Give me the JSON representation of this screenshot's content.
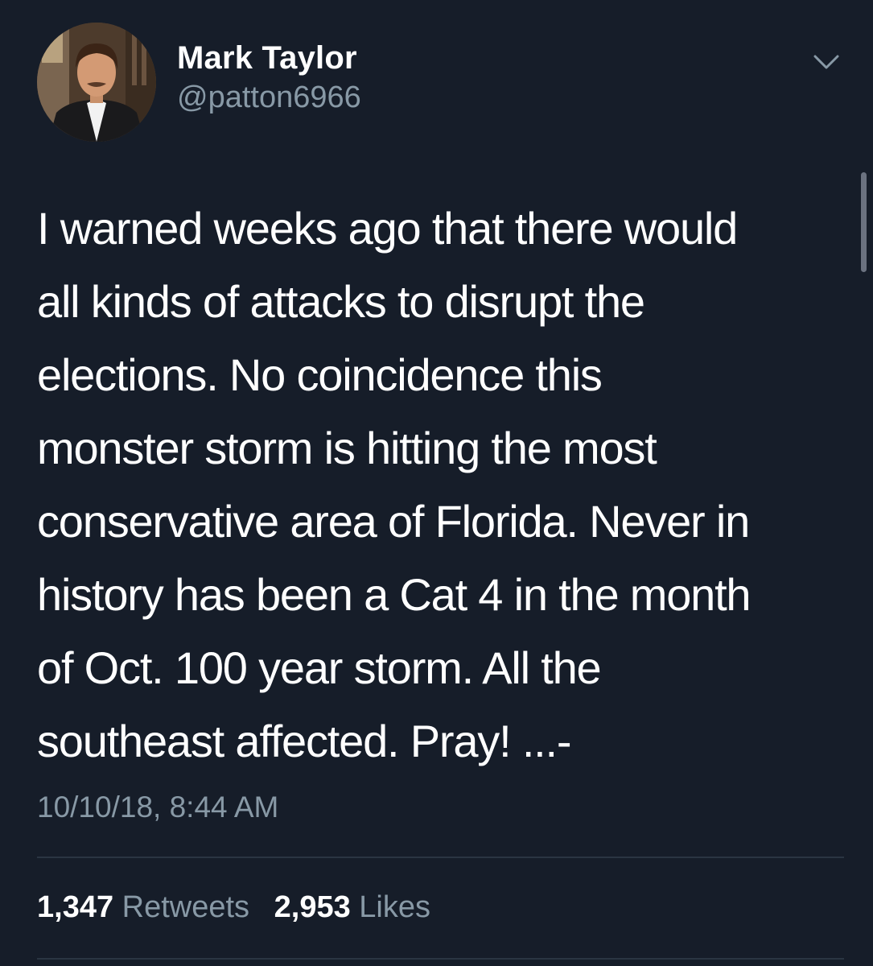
{
  "author": {
    "name": "Mark Taylor",
    "handle": "@patton6966",
    "avatar_icon": "profile-photo"
  },
  "menu_icon": "chevron-down-icon",
  "tweet": {
    "lines": [
      "I warned weeks ago that there would",
      "all kinds of attacks to disrupt the",
      "elections. No coincidence this",
      "monster storm is hitting the most",
      "conservative area of Florida. Never in",
      "history has been a Cat 4 in the month",
      "of Oct. 100 year storm. All the",
      "southeast affected. Pray! ...-"
    ],
    "timestamp": "10/10/18, 8:44 AM"
  },
  "stats": {
    "retweets_count": "1,347",
    "retweets_label": "Retweets",
    "likes_count": "2,953",
    "likes_label": "Likes"
  },
  "colors": {
    "background": "#161d29",
    "primary_text": "#ffffff",
    "secondary_text": "#8899a6",
    "divider": "#2a3542"
  }
}
